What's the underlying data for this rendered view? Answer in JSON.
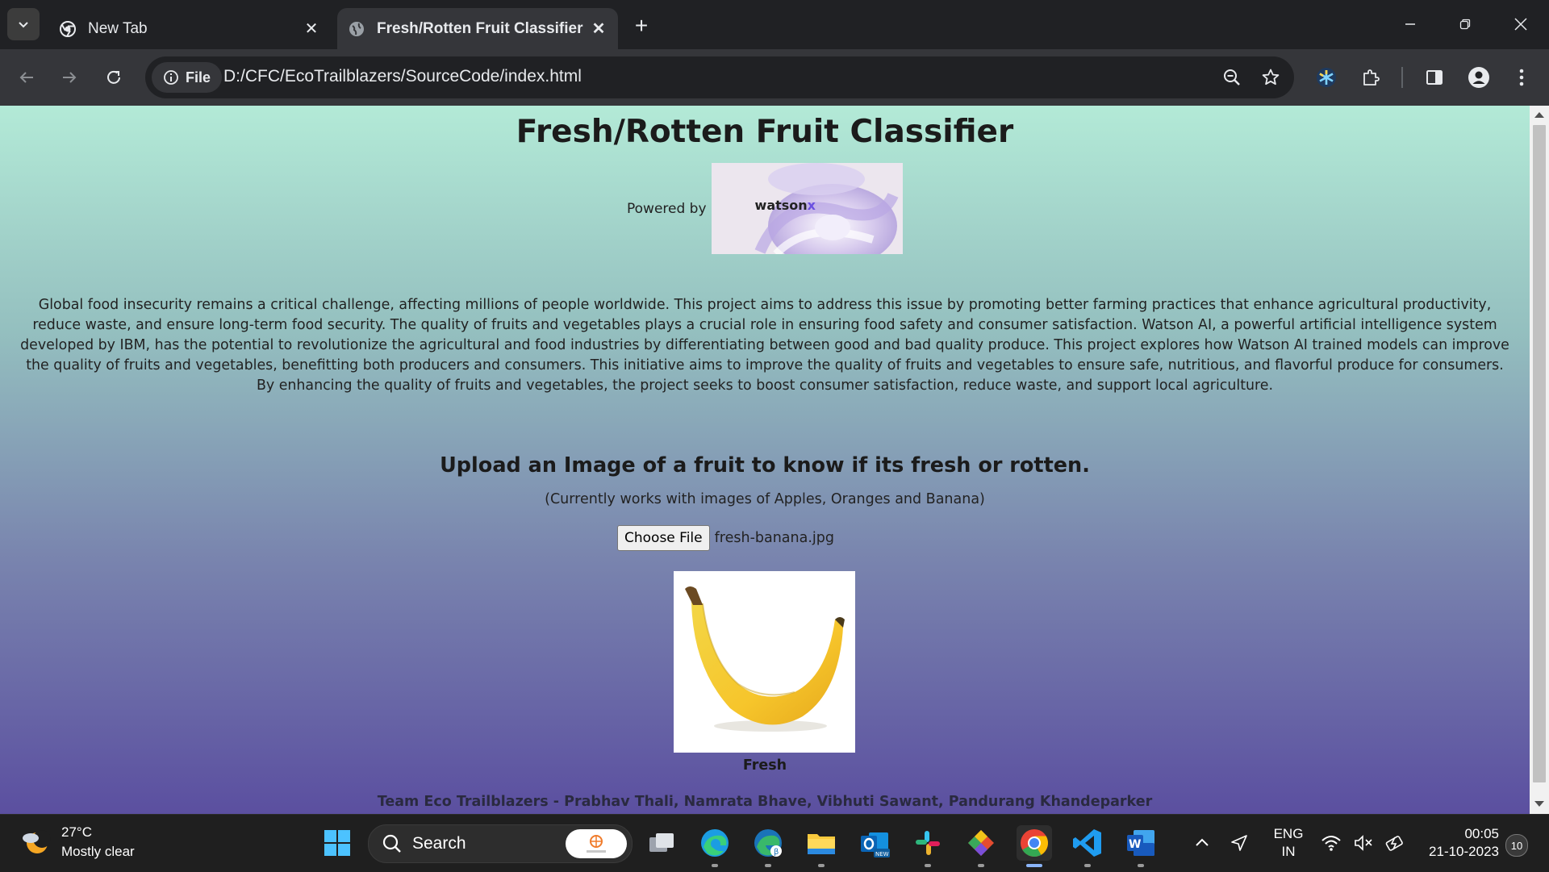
{
  "browser": {
    "tabs": [
      {
        "title": "New Tab",
        "active": false
      },
      {
        "title": "Fresh/Rotten Fruit Classifier",
        "active": true
      }
    ],
    "new_tab_symbol": "+",
    "address": {
      "scheme_chip": "File",
      "url": "D:/CFC/EcoTrailblazers/SourceCode/index.html"
    }
  },
  "page": {
    "title": "Fresh/Rotten Fruit Classifier",
    "powered_by": "Powered by",
    "logo_text": "watson",
    "logo_text_accent": "x",
    "description": "Global food insecurity remains a critical challenge, affecting millions of people worldwide. This project aims to address this issue by promoting better farming practices that enhance agricultural productivity, reduce waste, and ensure long-term food security. The quality of fruits and vegetables plays a crucial role in ensuring food safety and consumer satisfaction. Watson AI, a powerful artificial intelligence system developed by IBM, has the potential to revolutionize the agricultural and food industries by differentiating between good and bad quality produce. This project explores how Watson AI trained models can improve the quality of fruits and vegetables, benefitting both producers and consumers. This initiative aims to improve the quality of fruits and vegetables to ensure safe, nutritious, and flavorful produce for consumers. By enhancing the quality of fruits and vegetables, the project seeks to boost consumer satisfaction, reduce waste, and support local agriculture.",
    "upload_heading": "Upload an Image of a fruit to know if its fresh or rotten.",
    "note": "(Currently works with images of Apples, Oranges and Banana)",
    "choose_file_label": "Choose File",
    "selected_file": "fresh-banana.jpg",
    "result": "Fresh",
    "team": "Team Eco Trailblazers - Prabhav Thali, Namrata Bhave, Vibhuti Sawant, Pandurang Khandeparker"
  },
  "taskbar": {
    "weather_temp": "27°C",
    "weather_desc": "Mostly clear",
    "search_label": "Search",
    "apps": [
      "start-icon",
      "search-icon",
      "task-view-icon",
      "edge-icon",
      "edge-beta-icon",
      "file-explorer-icon",
      "outlook-icon",
      "slack-icon",
      "git-icon",
      "chrome-icon",
      "vscode-icon",
      "word-icon"
    ],
    "language_line1": "ENG",
    "language_line2": "IN",
    "time": "00:05",
    "date": "21-10-2023",
    "notification_count": "10"
  },
  "colors": {
    "page_gradient_top": "#b3ead7",
    "page_gradient_bottom": "#5b4fa0",
    "browser_frame": "#202124",
    "toolbar": "#35363a"
  }
}
